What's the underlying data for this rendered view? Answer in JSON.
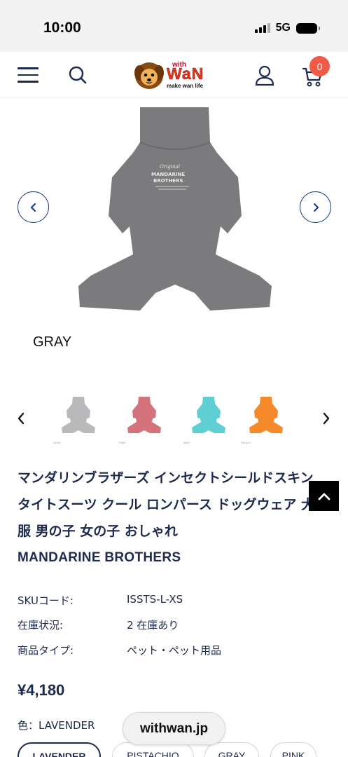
{
  "status_bar": {
    "time": "10:00",
    "network": "5G"
  },
  "header": {
    "logo": {
      "with": "with",
      "wan": "WaN",
      "tagline": "make wan life"
    },
    "cart_count": "0"
  },
  "gallery": {
    "caption": "GRAY",
    "main_color": "#7b7b7d"
  },
  "thumbnails": [
    {
      "label": "GRAY",
      "color": "#b9b9bb"
    },
    {
      "label": "PINK",
      "color": "#d4737c"
    },
    {
      "label": "MINT",
      "color": "#5fcfd3"
    },
    {
      "label": "PEACH",
      "color": "#f58a2a"
    }
  ],
  "product": {
    "title": "マンダリンブラザーズ インセクトシールドスキンタイトスーツ クール ロンパース ドッグウェア 犬服 男の子 女の子 おしゃれ",
    "brand": "MANDARINE BROTHERS",
    "meta": [
      {
        "label": "SKUコード:",
        "value": "ISSTS-L-XS"
      },
      {
        "label": "在庫状況:",
        "value": "2 在庫あり"
      },
      {
        "label": "商品タイプ:",
        "value": "ペット・ペット用品"
      }
    ],
    "price": "¥4,180",
    "variant_label": "色：LAVENDER",
    "variants": [
      "LAVENDER",
      "PISTACHIO",
      "GRAY",
      "PINK"
    ]
  },
  "browser": {
    "domain": "withwan.jp"
  },
  "colors": {
    "navy": "#1d2a4d",
    "accent": "#1d3d8f",
    "badge": "#f05a47"
  }
}
